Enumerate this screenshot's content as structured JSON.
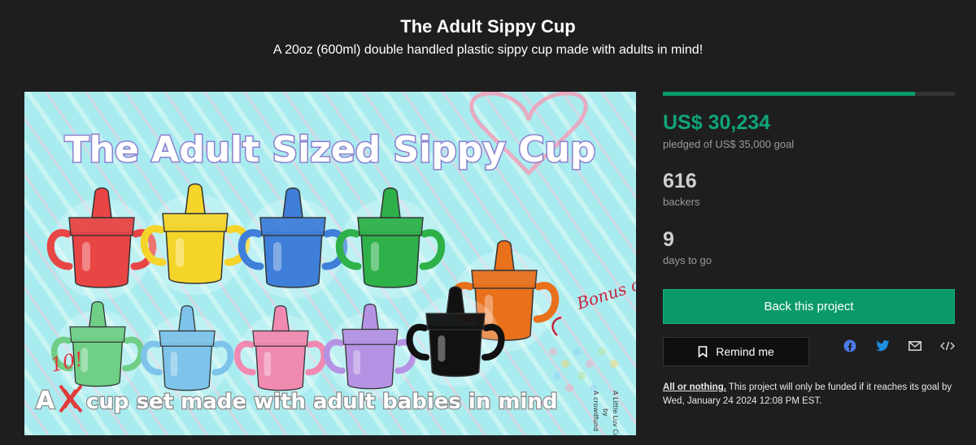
{
  "header": {
    "title": "The Adult Sippy Cup",
    "subtitle": "A 20oz (600ml) double handled plastic sippy cup made with adults in mind!"
  },
  "hero": {
    "headline": "The Adult Sized Sippy Cup",
    "tagline_prefix": "A",
    "tagline_struck": "X",
    "tagline_rest": "cup set made with adult babies in mind",
    "tagline_correction": "10!",
    "bonus": "Bonus color!",
    "credit": [
      "A crowdfund",
      "by",
      "A Little Luv Co."
    ],
    "cup_colors": [
      "#e84545",
      "#f5d52a",
      "#3f7fd9",
      "#2fb14a",
      "#e9711c",
      "#6fcf86",
      "#7ec3ea",
      "#f08ab0",
      "#b592e3",
      "#111111"
    ]
  },
  "campaign": {
    "funded_fraction": 0.864,
    "pledged": "US$ 30,234",
    "pledged_sub": "pledged of US$ 35,000 goal",
    "backers": "616",
    "backers_sub": "backers",
    "days": "9",
    "days_sub": "days to go",
    "back_label": "Back this project",
    "remind_label": "Remind me",
    "terms_link": "All or nothing.",
    "terms_text": " This project will only be funded if it reaches its goal by Wed, January 24 2024 12:08 PM EST."
  },
  "social": {
    "icons": [
      "facebook-icon",
      "twitter-icon",
      "email-icon",
      "embed-icon"
    ],
    "colors": {
      "facebook": "#4a79e8",
      "twitter": "#1d8fe0",
      "muted": "#cfcfcf"
    }
  }
}
